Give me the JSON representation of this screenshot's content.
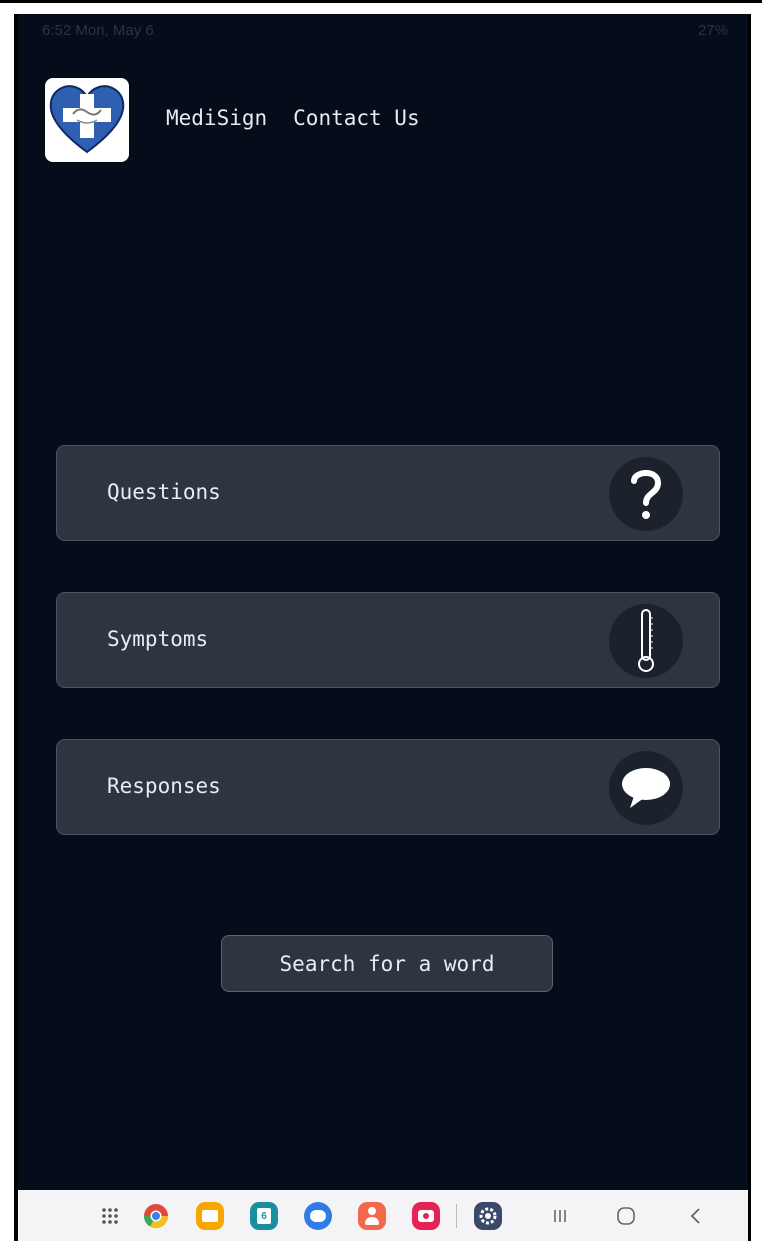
{
  "status_bar": {
    "left": "6:52  Mon, May 6",
    "right": "27%"
  },
  "header": {
    "logo_icon": "medisign-heart-logo",
    "nav_items": [
      "MediSign",
      "Contact Us"
    ]
  },
  "menu": [
    {
      "label": "Questions",
      "icon": "question-mark-icon"
    },
    {
      "label": "Symptoms",
      "icon": "thermometer-icon"
    },
    {
      "label": "Responses",
      "icon": "speech-bubble-icon"
    }
  ],
  "search_button": {
    "label": "Search for a word"
  },
  "taskbar": {
    "apps": [
      "apps-grid-icon",
      "chrome-icon",
      "files-icon",
      "calendar-icon",
      "messages-icon",
      "contacts-icon",
      "camera-icon",
      "settings-icon"
    ],
    "nav": [
      "recents-icon",
      "home-icon",
      "back-icon"
    ],
    "calendar_day": "6"
  },
  "colors": {
    "background": "#050d1a",
    "card": "#2e3541",
    "logo_heart": "#2f5fb0",
    "text": "#e9edf2"
  }
}
